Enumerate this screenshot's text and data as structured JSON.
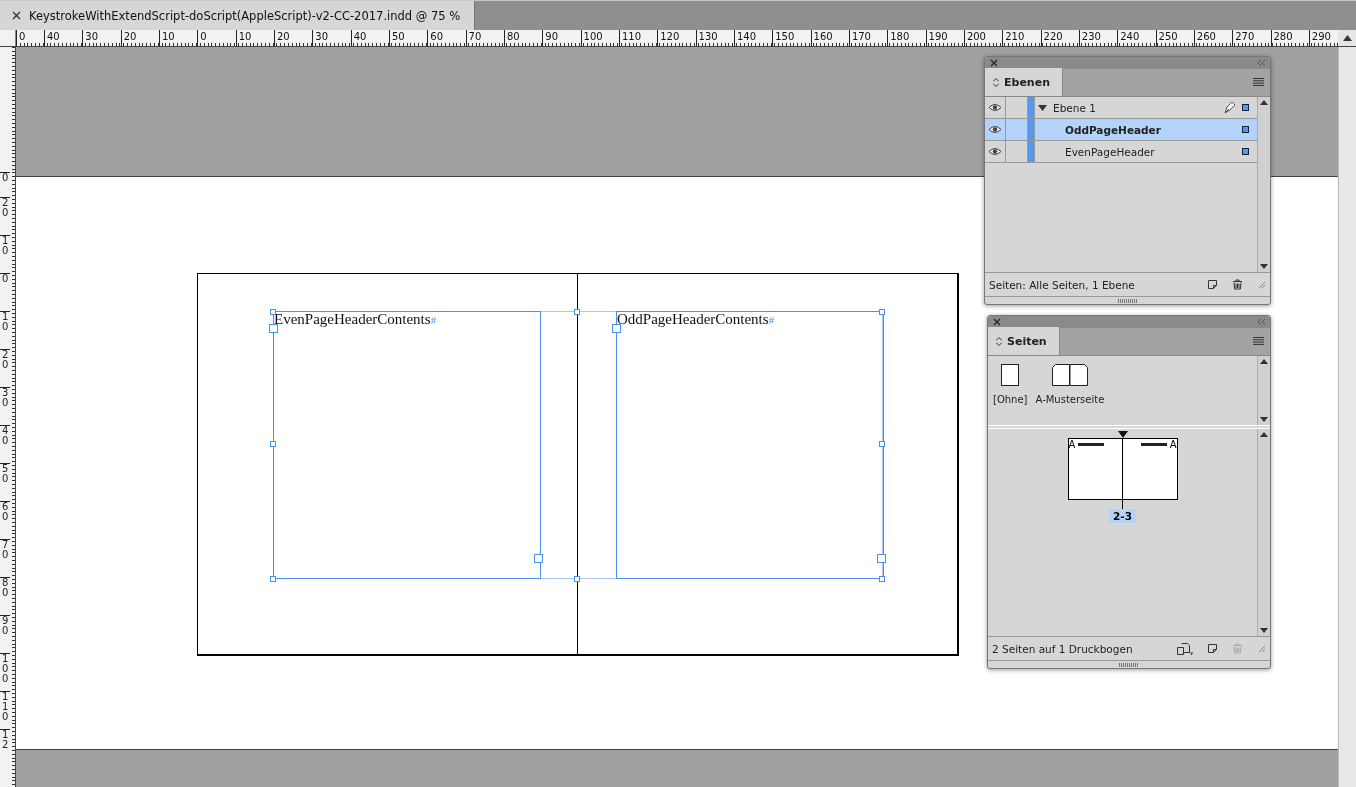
{
  "document_tab": {
    "title": "KeystrokeWithExtendScript-doScript(AppleScript)-v2-CC-2017.indd @ 75 %"
  },
  "ruler_horizontal": {
    "labels": [
      "0",
      "40",
      "30",
      "20",
      "10",
      "0",
      "10",
      "20",
      "30",
      "40",
      "50",
      "60",
      "70",
      "80",
      "90",
      "100",
      "110",
      "120",
      "130",
      "140",
      "150",
      "160",
      "170",
      "180",
      "190",
      "200",
      "210",
      "220",
      "230",
      "240",
      "250",
      "260",
      "270",
      "280",
      "290"
    ]
  },
  "ruler_vertical": {
    "labels": [
      "0",
      "20",
      "10",
      "0",
      "10",
      "20",
      "30",
      "40",
      "50",
      "60",
      "70",
      "80",
      "90",
      "100",
      "110",
      "12"
    ]
  },
  "spread": {
    "frames": [
      {
        "text": "EvenPageHeaderContents",
        "end_mark": "#"
      },
      {
        "text": "OddPageHeaderContents",
        "end_mark": "#"
      }
    ]
  },
  "layers_panel": {
    "tab": "Ebenen",
    "layers": [
      {
        "name": "Ebene 1",
        "visible": true,
        "expanded": true,
        "active": true,
        "selected": false,
        "children": [
          {
            "name": "OddPageHeader",
            "visible": true,
            "active": false,
            "selected": true
          },
          {
            "name": "EvenPageHeader",
            "visible": true,
            "active": false,
            "selected": false
          }
        ]
      }
    ],
    "status": "Seiten: Alle Seiten, 1 Ebene"
  },
  "pages_panel": {
    "tab": "Seiten",
    "masters": [
      {
        "name": "[Ohne]",
        "kind": "single"
      },
      {
        "name": "A-Musterseite",
        "kind": "spread"
      }
    ],
    "spreads": [
      {
        "label": "2-3",
        "selected": true,
        "left_prefix": "A",
        "right_prefix": "A"
      }
    ],
    "status": "2 Seiten auf 1 Druckbogen"
  }
}
